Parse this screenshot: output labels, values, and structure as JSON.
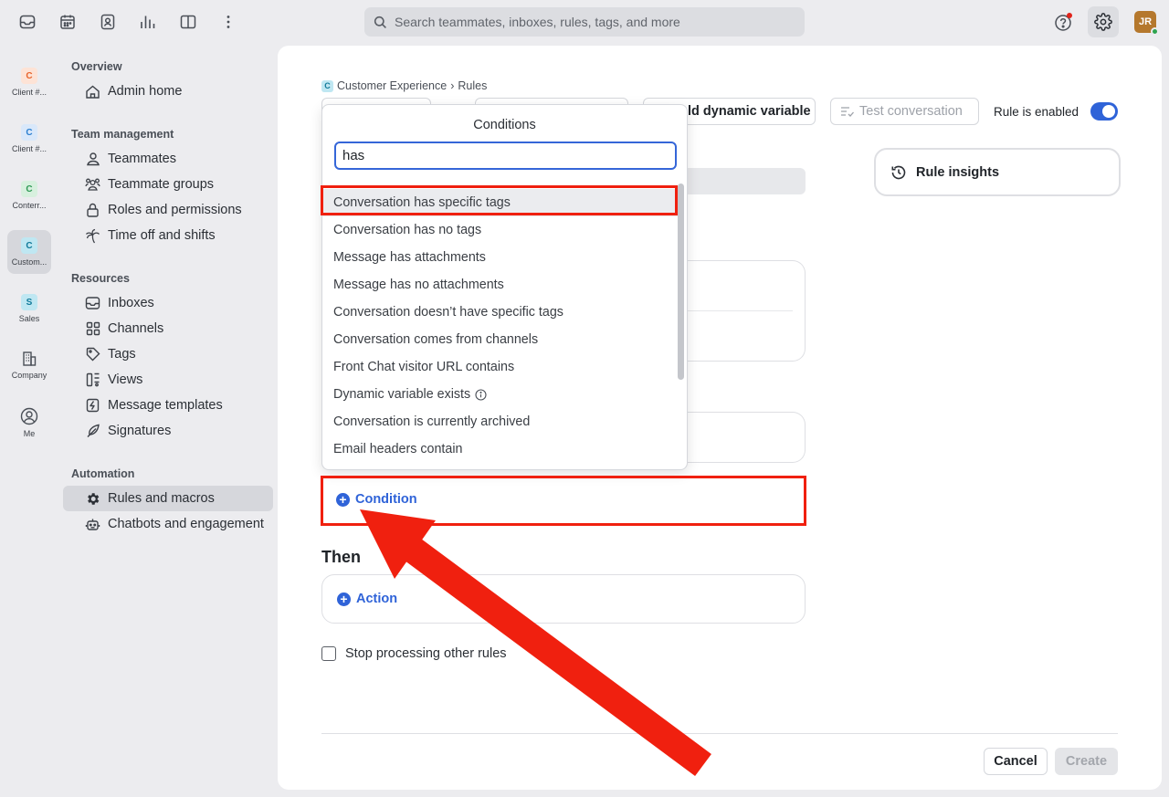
{
  "topbar": {
    "icons": [
      "inbox-icon",
      "calendar-icon",
      "contacts-icon",
      "analytics-icon",
      "split-view-icon",
      "more-icon"
    ],
    "search_placeholder": "Search teammates, inboxes, rules, tags, and more",
    "user_initials": "JR"
  },
  "workspaces": [
    {
      "initial": "C",
      "label": "Client #...",
      "color": "#e8642c",
      "bg": "#fde3d6"
    },
    {
      "initial": "C",
      "label": "Client #...",
      "color": "#2b7fd0",
      "bg": "#d9e8fa"
    },
    {
      "initial": "C",
      "label": "Conterr...",
      "color": "#2f9a55",
      "bg": "#d7f0de"
    },
    {
      "initial": "C",
      "label": "Custom...",
      "color": "#117a9a",
      "bg": "#bfe7f2"
    },
    {
      "initial": "S",
      "label": "Sales",
      "color": "#117a9a",
      "bg": "#bfe7f2"
    },
    {
      "initial": "",
      "label": "Company",
      "color": "",
      "bg": ""
    },
    {
      "initial": "",
      "label": "Me",
      "color": "",
      "bg": ""
    }
  ],
  "nav": {
    "overview": "Overview",
    "admin_home": "Admin home",
    "team_management": "Team management",
    "teammates": "Teammates",
    "teammate_groups": "Teammate groups",
    "roles": "Roles and permissions",
    "time_off": "Time off and shifts",
    "resources": "Resources",
    "inboxes": "Inboxes",
    "channels": "Channels",
    "tags": "Tags",
    "views": "Views",
    "message_templates": "Message templates",
    "signatures": "Signatures",
    "automation": "Automation",
    "rules_macros": "Rules and macros",
    "chatbots": "Chatbots and engagement"
  },
  "main": {
    "breadcrumb_badge": "C",
    "breadcrumb_workspace": "Customer Experience",
    "breadcrumb_sep": "›",
    "breadcrumb_page": "Rules",
    "dynamic_variable_label": "ld dynamic variable",
    "test_conversation_label": "Test conversation",
    "rule_enabled_label": "Rule is enabled",
    "rule_insights_label": "Rule insights",
    "condition_label": "Condition",
    "then_label": "Then",
    "action_label": "Action",
    "stop_processing_label": "Stop processing other rules",
    "cancel_label": "Cancel",
    "create_label": "Create"
  },
  "dropdown": {
    "title": "Conditions",
    "search_value": "has",
    "items": [
      "Conversation has specific tags",
      "Conversation has no tags",
      "Message has attachments",
      "Message has no attachments",
      "Conversation doesn’t have specific tags",
      "Conversation comes from channels",
      "Front Chat visitor URL contains",
      "Dynamic variable exists",
      "Conversation is currently archived",
      "Email headers contain"
    ],
    "highlighted_index": 0
  },
  "colors": {
    "accent": "#2f63d8",
    "annotation": "#f0200f"
  }
}
